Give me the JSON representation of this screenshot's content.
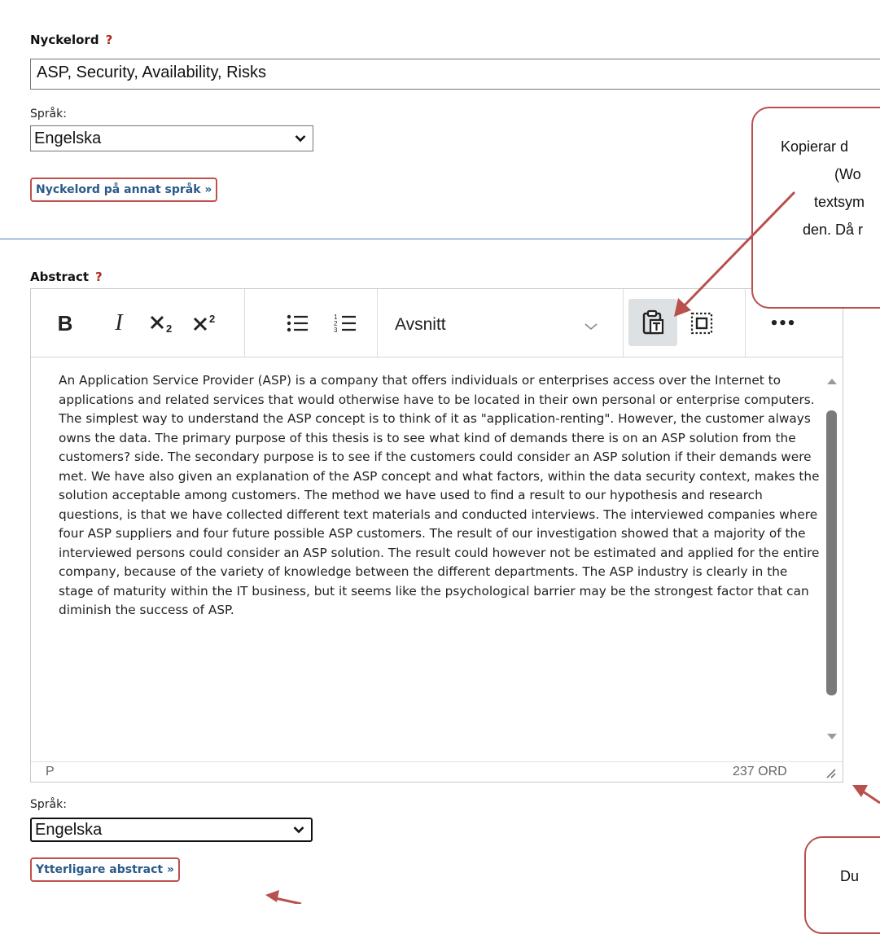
{
  "keywords": {
    "label": "Nyckelord",
    "help": "?",
    "value": "ASP, Security, Availability, Risks",
    "language_label": "Språk:",
    "language_value": "Engelska",
    "other_language_button": "Nyckelord på annat språk »"
  },
  "abstract": {
    "label": "Abstract",
    "help": "?",
    "toolbar": {
      "bold": "B",
      "italic": "I",
      "format_value": "Avsnitt",
      "more": "•••"
    },
    "text": "An Application Service Provider (ASP) is a company that offers individuals or enterprises access over the Internet to applications and related services that would otherwise have to be located in their own personal or enterprise computers. The simplest way to understand the ASP concept is to think of it as \"application-renting\". However, the customer always owns the data. The primary purpose of this thesis is to see what kind of demands there is on an ASP solution from the customers? side. The secondary purpose is to see if the customers could consider an ASP solution if their demands were met. We have also given an explanation of the ASP concept and what factors, within the data security context, makes the solution acceptable among customers. The method we have used to find a result to our hypothesis and research questions, is that we have collected different text materials and conducted interviews. The interviewed companies where four ASP suppliers and four future possible ASP customers. The result of our investigation showed that a majority of the interviewed persons could consider an ASP solution. The result could however not be estimated and applied for the entire company, because of the variety of knowledge between the different departments. The ASP industry is clearly in the stage of maturity within the IT business, but it seems like the psychological barrier may be the strongest factor that can diminish the success of ASP.",
    "status_path": "P",
    "word_count": "237 ORD",
    "language_label": "Språk:",
    "language_value": "Engelska",
    "more_button": "Ytterligare abstract »"
  },
  "callouts": {
    "top": [
      "Kopierar d",
      "(Wo",
      "textsym",
      "den. Då r"
    ],
    "bottom": [
      "Du"
    ]
  },
  "colors": {
    "callout_border": "#b8504c",
    "link_text": "#2a5a8a",
    "help_mark": "#b3261e",
    "divider": "#4f7fb5"
  }
}
